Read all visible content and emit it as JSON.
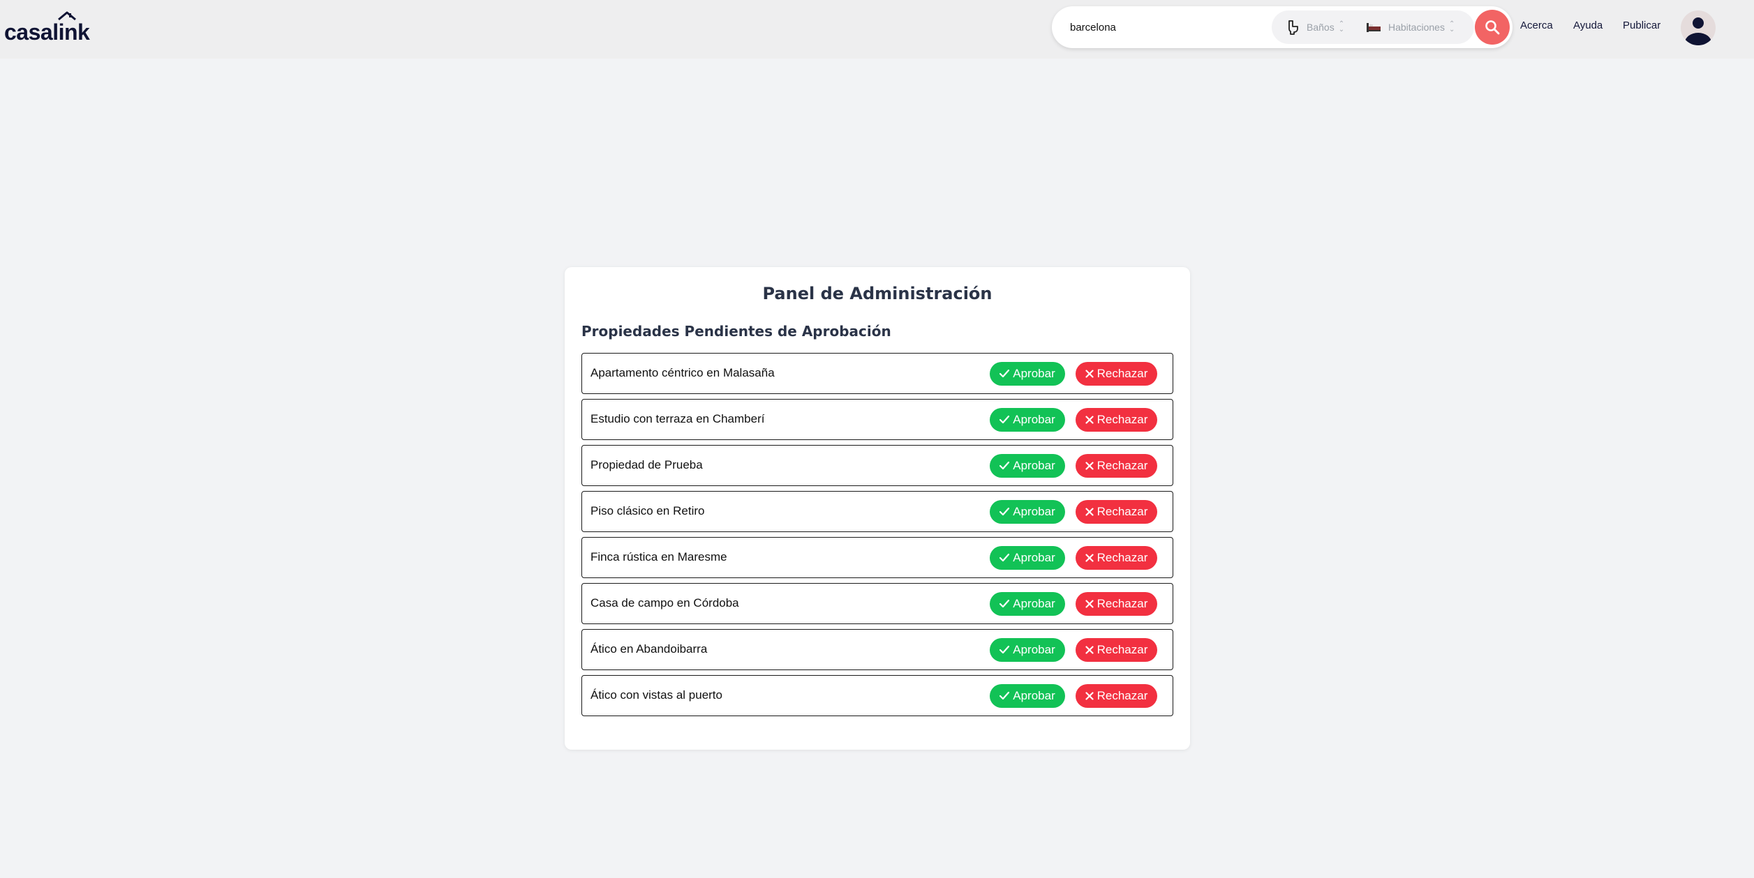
{
  "header": {
    "logo_text": "casalink",
    "search": {
      "value": "barcelona"
    },
    "filters": [
      {
        "label": "Baños",
        "icon": "toilet-icon"
      },
      {
        "label": "Habitaciones",
        "icon": "bed-icon"
      }
    ],
    "nav": [
      "Acerca",
      "Ayuda",
      "Publicar"
    ]
  },
  "panel": {
    "title": "Panel de Administración",
    "section_title": "Propiedades Pendientes de Aprobación",
    "approve_label": "Aprobar",
    "reject_label": "Rechazar",
    "properties": [
      "Apartamento céntrico en Malasaña",
      "Estudio con terraza en Chamberí",
      "Propiedad de Prueba",
      "Piso clásico en Retiro",
      "Finca rústica en Maresme",
      "Casa de campo en Córdoba",
      "Ático en Abandoibarra",
      "Ático con vistas al puerto"
    ]
  },
  "colors": {
    "approve": "#12c256",
    "reject": "#f23040",
    "search_button": "#f26464",
    "brand": "#101434"
  }
}
